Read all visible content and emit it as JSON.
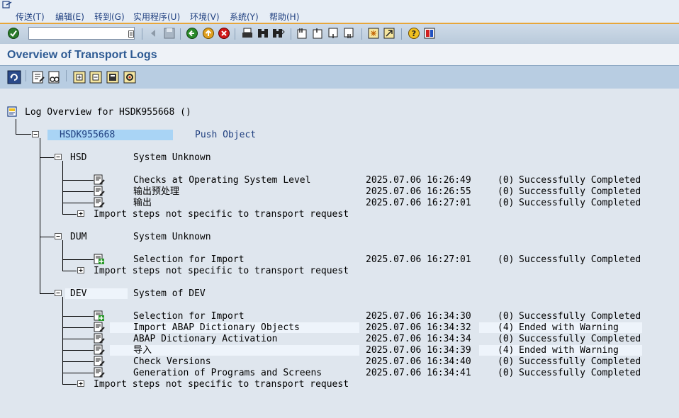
{
  "menu": {
    "items": [
      "传送(T)",
      "编辑(E)",
      "转到(G)",
      "实用程序(U)",
      "环境(V)",
      "系统(Y)",
      "帮助(H)"
    ]
  },
  "toolbar": {
    "command_field_value": ""
  },
  "title": "Overview of Transport Logs",
  "tree": {
    "root_label": "Log Overview for HSDK955668 ()",
    "request": {
      "id": "HSDK955668",
      "action": "Push Object"
    },
    "systems": [
      {
        "name": "HSD",
        "desc": "System Unknown",
        "steps": [
          {
            "label": "Checks at Operating System Level",
            "timestamp": "2025.07.06 16:26:49",
            "rc": "(0)",
            "status": "Successfully Completed"
          },
          {
            "label": "输出预处理",
            "timestamp": "2025.07.06 16:26:55",
            "rc": "(0)",
            "status": "Successfully Completed"
          },
          {
            "label": "输出",
            "timestamp": "2025.07.06 16:27:01",
            "rc": "(0)",
            "status": "Successfully Completed"
          }
        ],
        "footer": "Import steps not specific to transport request"
      },
      {
        "name": "DUM",
        "desc": "System Unknown",
        "steps": [
          {
            "label": "Selection for Import",
            "timestamp": "2025.07.06 16:27:01",
            "rc": "(0)",
            "status": "Successfully Completed"
          }
        ],
        "footer": "Import steps not specific to transport request"
      },
      {
        "name": "DEV",
        "desc": "System of DEV",
        "steps": [
          {
            "label": "Selection for Import",
            "timestamp": "2025.07.06 16:34:30",
            "rc": "(0)",
            "status": "Successfully Completed"
          },
          {
            "label": "Import ABAP Dictionary Objects",
            "timestamp": "2025.07.06 16:34:32",
            "rc": "(4)",
            "status": "Ended with Warning"
          },
          {
            "label": "ABAP Dictionary Activation",
            "timestamp": "2025.07.06 16:34:34",
            "rc": "(0)",
            "status": "Successfully Completed"
          },
          {
            "label": "导入",
            "timestamp": "2025.07.06 16:34:39",
            "rc": "(4)",
            "status": "Ended with Warning"
          },
          {
            "label": "Check Versions",
            "timestamp": "2025.07.06 16:34:40",
            "rc": "(0)",
            "status": "Successfully Completed"
          },
          {
            "label": "Generation of Programs and Screens",
            "timestamp": "2025.07.06 16:34:41",
            "rc": "(0)",
            "status": "Successfully Completed"
          }
        ],
        "footer": "Import steps not specific to transport request"
      }
    ]
  }
}
